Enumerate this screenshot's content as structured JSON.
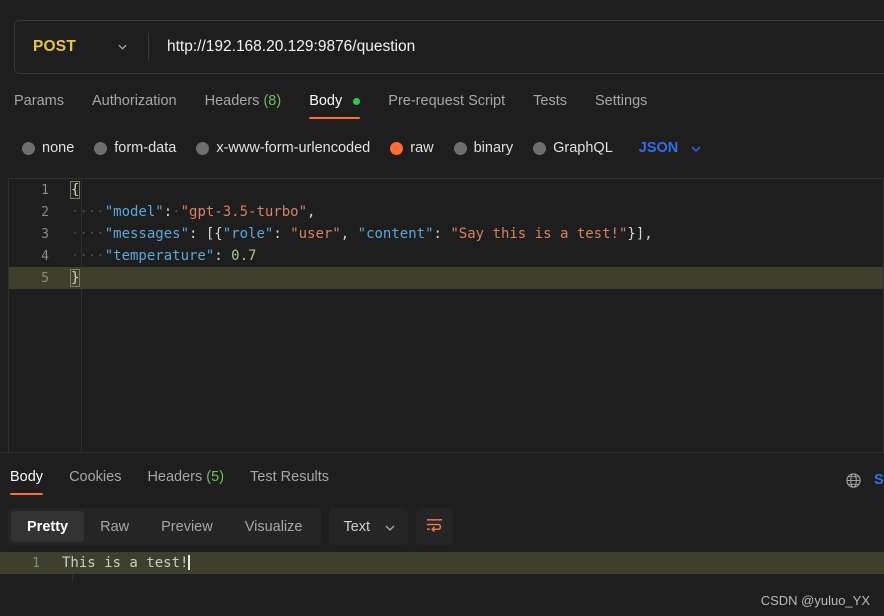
{
  "url_bar": {
    "method": "POST",
    "method_chevron_icon": "chevron-down-icon",
    "url": "http://192.168.20.129:9876/question"
  },
  "request_tabs": [
    {
      "label": "Params",
      "active": false
    },
    {
      "label": "Authorization",
      "active": false
    },
    {
      "label": "Headers",
      "count": "(8)",
      "active": false
    },
    {
      "label": "Body",
      "active": true,
      "dot": true
    },
    {
      "label": "Pre-request Script",
      "active": false
    },
    {
      "label": "Tests",
      "active": false
    },
    {
      "label": "Settings",
      "active": false
    }
  ],
  "body_types": [
    {
      "label": "none",
      "selected": false
    },
    {
      "label": "form-data",
      "selected": false
    },
    {
      "label": "x-www-form-urlencoded",
      "selected": false
    },
    {
      "label": "raw",
      "selected": true
    },
    {
      "label": "binary",
      "selected": false
    },
    {
      "label": "GraphQL",
      "selected": false
    }
  ],
  "raw_format": {
    "label": "JSON",
    "chevron_icon": "chevron-down-icon"
  },
  "editor": {
    "lines": [
      {
        "num": "1",
        "highlight": false
      },
      {
        "num": "2",
        "highlight": false
      },
      {
        "num": "3",
        "highlight": false
      },
      {
        "num": "4",
        "highlight": false
      },
      {
        "num": "5",
        "highlight": true
      }
    ],
    "line1_brace": "{",
    "line2_indent": "····",
    "line2_key": "\"model\"",
    "line2_colon": ":",
    "line2_sep": "·",
    "line2_value": "\"gpt-3.5-turbo\"",
    "line2_comma": ",",
    "line3_indent": "····",
    "line3_key": "\"messages\"",
    "line3_colon": ":",
    "line3_open": " [{",
    "line3_key2": "\"role\"",
    "line3_colon2": ":",
    "line3_val2": " \"user\"",
    "line3_comma2": ",",
    "line3_key3": " \"content\"",
    "line3_colon3": ":",
    "line3_val3": " \"Say this is a test!\"",
    "line3_close": "}],",
    "line4_indent": "····",
    "line4_key": "\"temperature\"",
    "line4_colon": ":",
    "line4_value": " 0.7",
    "line5_brace": "}"
  },
  "response_tabs": [
    {
      "label": "Body",
      "active": true
    },
    {
      "label": "Cookies",
      "active": false
    },
    {
      "label": "Headers",
      "count": "(5)",
      "active": false
    },
    {
      "label": "Test Results",
      "active": false
    }
  ],
  "response_right": {
    "globe_icon": "globe-icon",
    "cut_off_text": "S"
  },
  "format_toolbar": {
    "buttons": [
      {
        "label": "Pretty",
        "active": true
      },
      {
        "label": "Raw",
        "active": false
      },
      {
        "label": "Preview",
        "active": false
      },
      {
        "label": "Visualize",
        "active": false
      }
    ],
    "type_select": {
      "label": "Text",
      "chevron_icon": "chevron-down-icon"
    },
    "wrap_button_icon": "word-wrap-icon"
  },
  "response_body": {
    "line_number": "1",
    "text": "This is a test!"
  },
  "watermark": "CSDN @yuluo_YX",
  "colors": {
    "accent_orange": "#ff6c37",
    "method_yellow": "#e8c547",
    "json_blue": "#2f6feb",
    "count_green": "#6bbf59",
    "dot_green": "#2ecc4a",
    "bg": "#1e1e1e",
    "selection": "#3f3f2e"
  }
}
